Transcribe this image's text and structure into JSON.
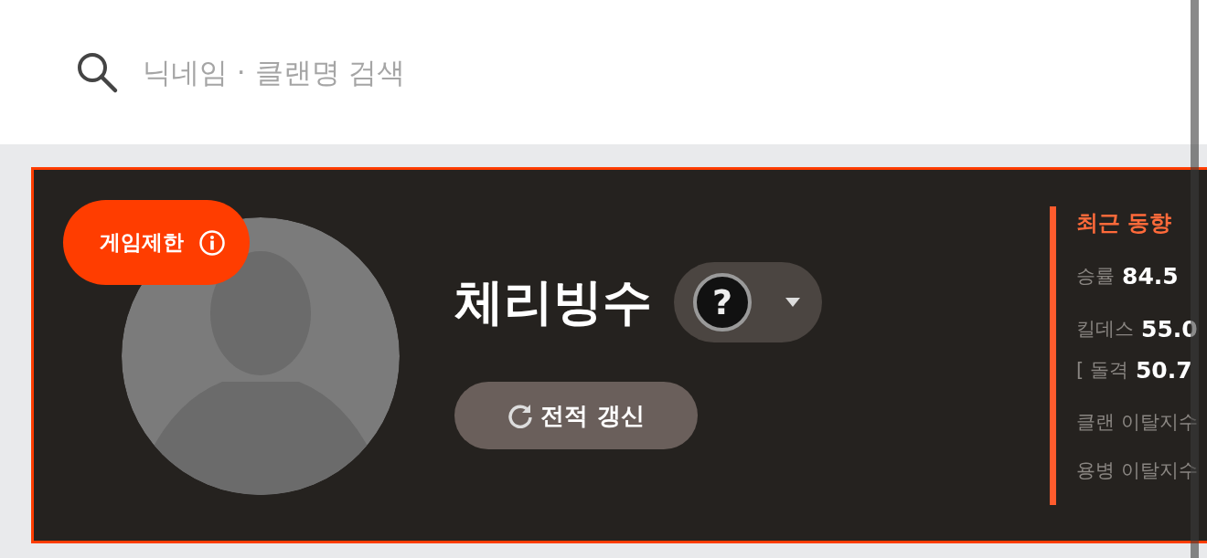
{
  "search": {
    "placeholder": "닉네임 · 클랜명 검색"
  },
  "profile": {
    "badge": "게임제한",
    "name": "체리빙수",
    "rank_icon": "?",
    "refresh_button": "전적 갱신"
  },
  "recent": {
    "title": "최근 동향",
    "stats": [
      {
        "kind": "value",
        "label": "승률",
        "value": "84.5"
      },
      {
        "kind": "value",
        "label": "킬데스",
        "value": "55.0"
      },
      {
        "kind": "value",
        "label": "[ 돌격",
        "value": "50.7"
      },
      {
        "kind": "plain",
        "label": "클랜 이탈지수"
      },
      {
        "kind": "plain",
        "label": "용병 이탈지수"
      }
    ]
  }
}
